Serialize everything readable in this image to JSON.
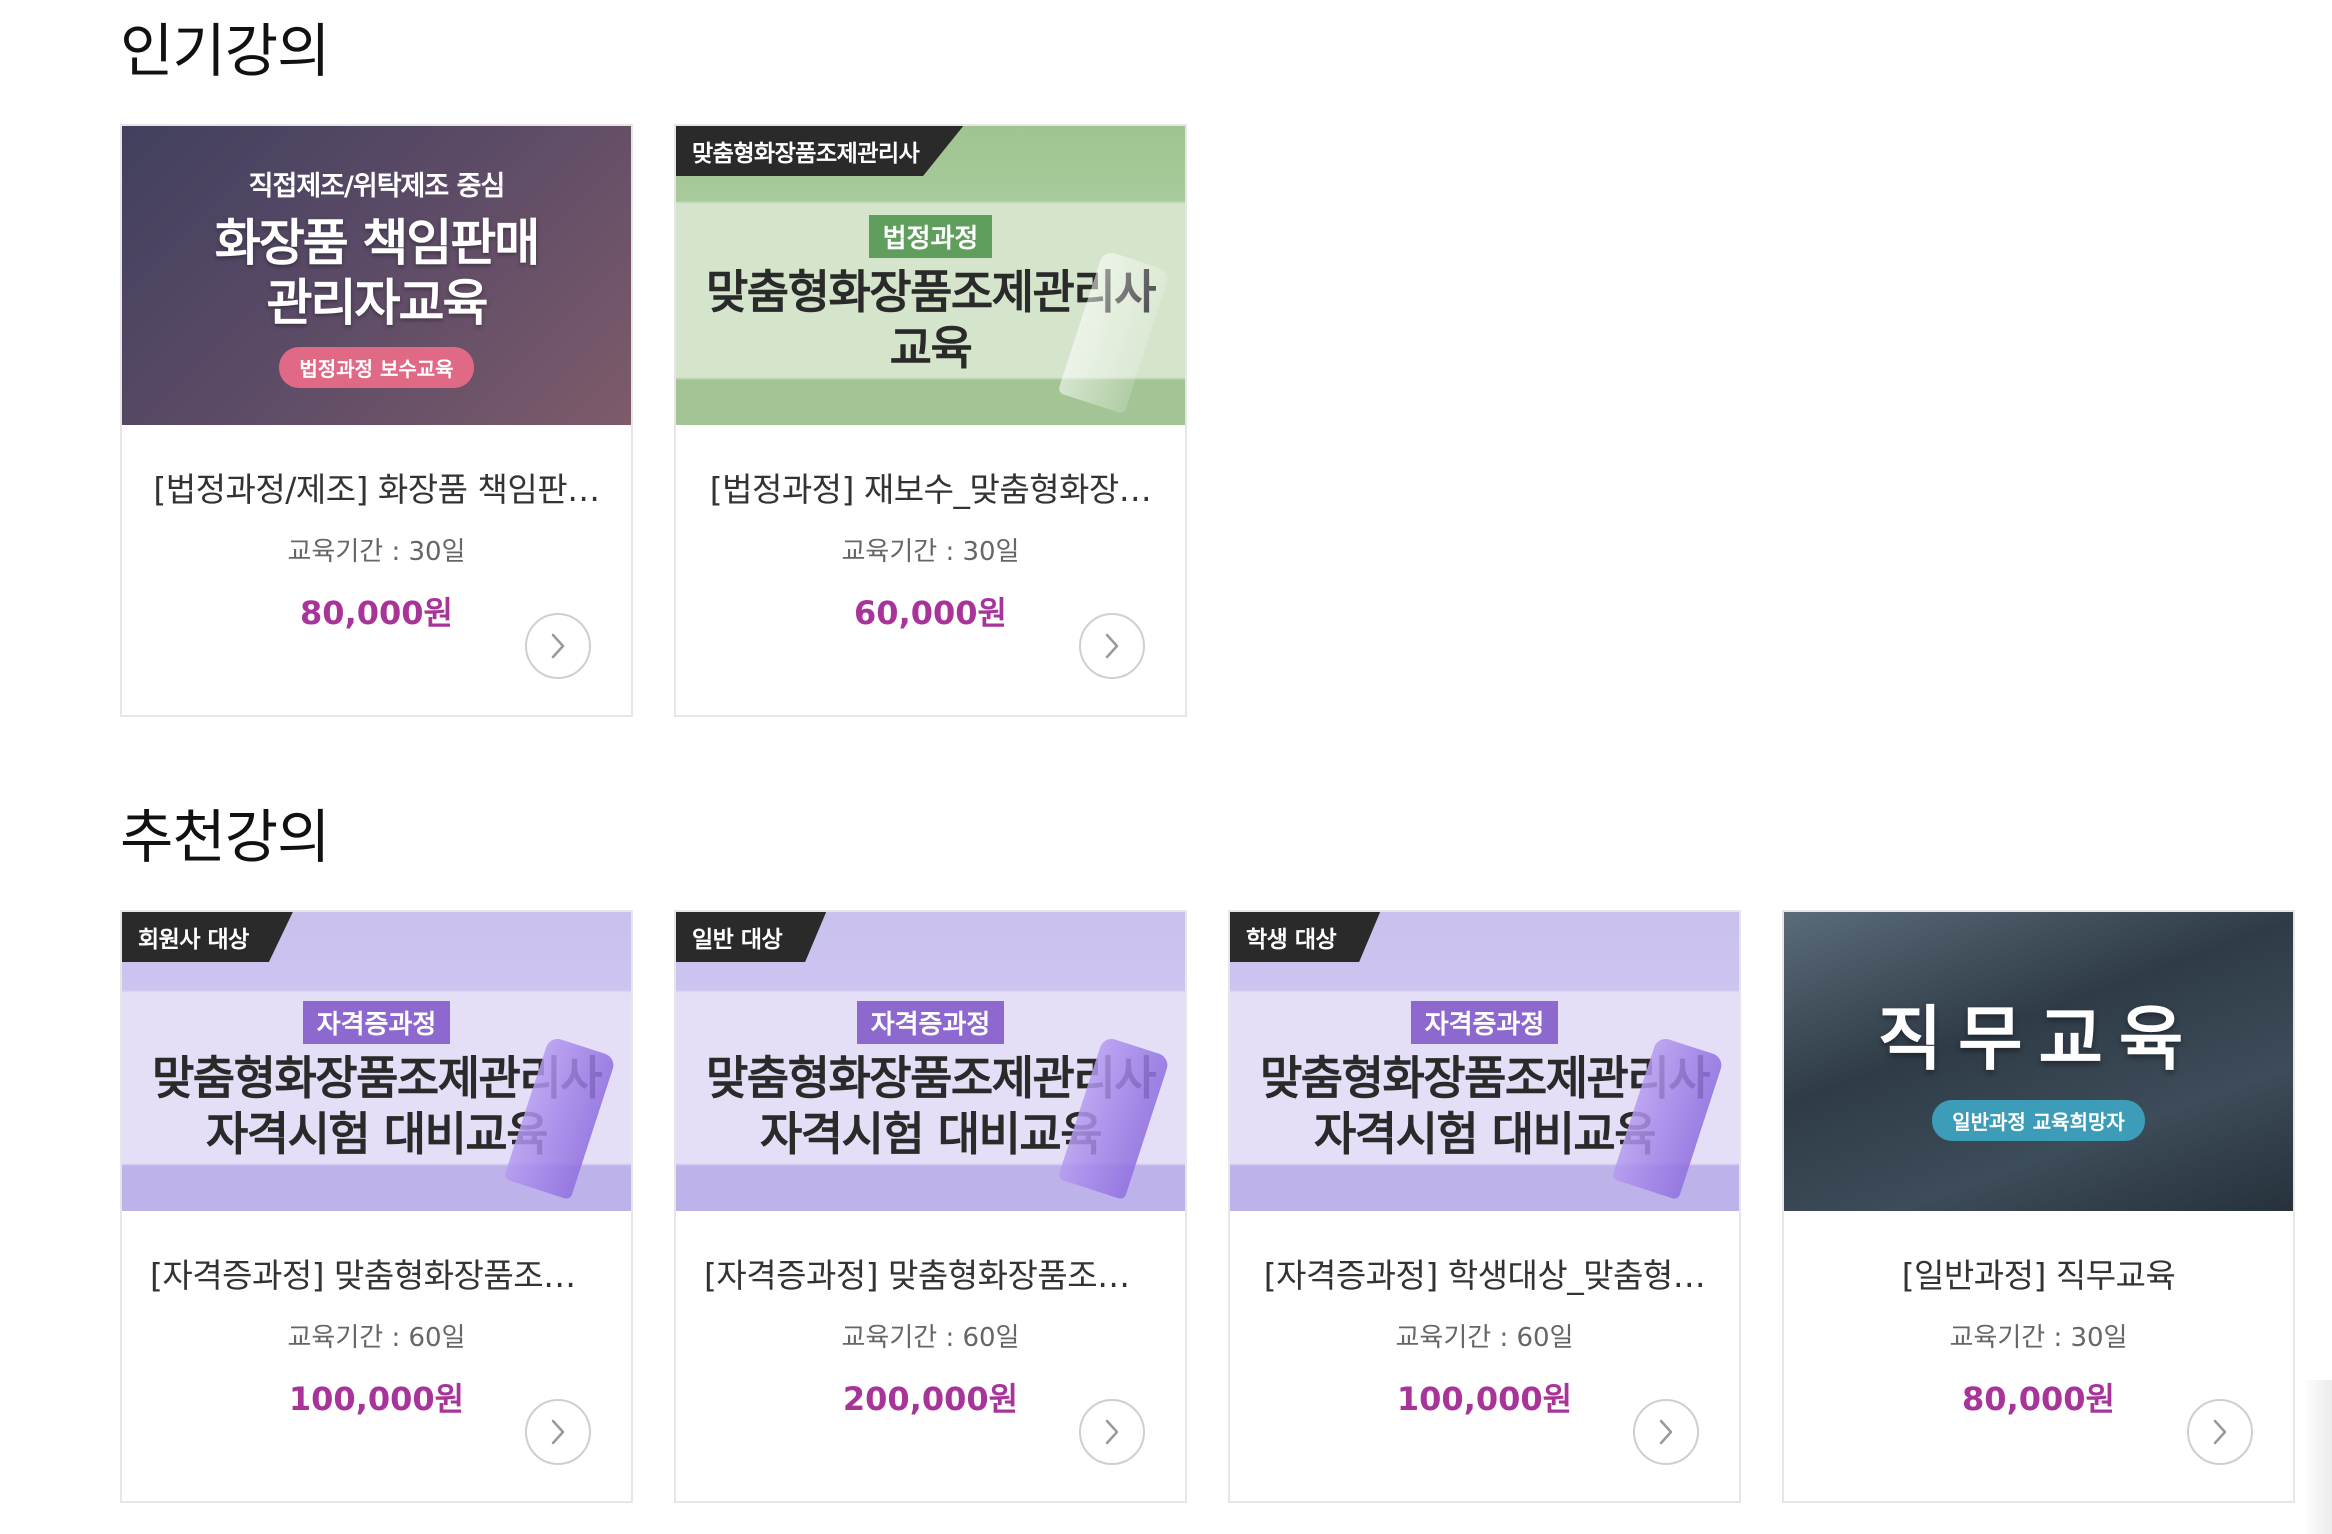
{
  "popular": {
    "heading": "인기강의",
    "cards": [
      {
        "thumb": {
          "sub": "직접제조/위탁제조 중심",
          "line1": "화장품 책임판매",
          "line2": "관리자교육",
          "badge": "법정과정 보수교육"
        },
        "title": "[법정과정/제조] 화장품 책임판…",
        "period": "교육기간 : 30일",
        "price": "80,000원"
      },
      {
        "thumb": {
          "corner": "맞춤형화장품조제관리사",
          "tag": "법정과정",
          "line1": "맞춤형화장품조제관리사",
          "line2": "교육"
        },
        "title": "[법정과정] 재보수_맞춤형화장…",
        "period": "교육기간 : 30일",
        "price": "60,000원"
      }
    ]
  },
  "recommended": {
    "heading": "추천강의",
    "cards": [
      {
        "thumb": {
          "corner": "회원사 대상",
          "tag": "자격증과정",
          "line1": "맞춤형화장품조제관리사",
          "line2": "자격시험 대비교육"
        },
        "title": "[자격증과정] 맞춤형화장품조제…",
        "period": "교육기간 : 60일",
        "price": "100,000원"
      },
      {
        "thumb": {
          "corner": "일반 대상",
          "tag": "자격증과정",
          "line1": "맞춤형화장품조제관리사",
          "line2": "자격시험 대비교육"
        },
        "title": "[자격증과정] 맞춤형화장품조제…",
        "period": "교육기간 : 60일",
        "price": "200,000원"
      },
      {
        "thumb": {
          "corner": "학생 대상",
          "tag": "자격증과정",
          "line1": "맞춤형화장품조제관리사",
          "line2": "자격시험 대비교육"
        },
        "title": "[자격증과정] 학생대상_맞춤형…",
        "period": "교육기간 : 60일",
        "price": "100,000원"
      },
      {
        "thumb": {
          "line1": "직무교육",
          "badge": "일반과정 교육희망자"
        },
        "title": "[일반과정] 직무교육",
        "period": "교육기간 : 30일",
        "price": "80,000원"
      }
    ]
  },
  "icons": {
    "go": "chevron-right-circle-icon"
  },
  "colors": {
    "price": "#a8349a",
    "heading": "#111111",
    "tag_purple": "#8c68cf",
    "tag_green": "#5f9e5c"
  }
}
